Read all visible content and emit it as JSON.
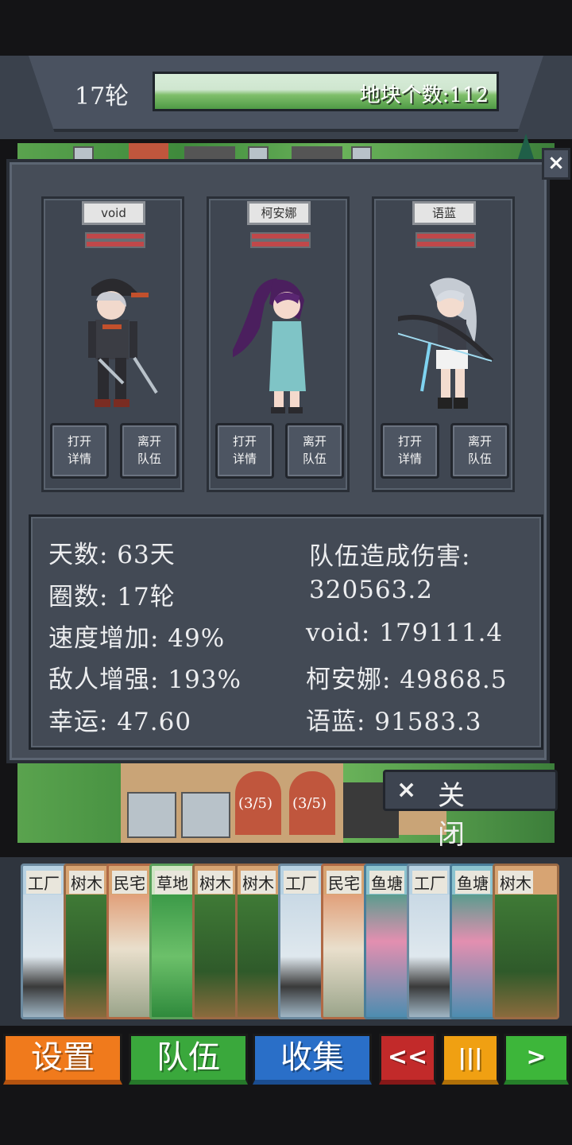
{
  "header": {
    "round": "17轮",
    "tile_count": "地块个数:112"
  },
  "party": [
    {
      "name": "void",
      "buttons": [
        "打开\n详情",
        "离开\n队伍"
      ]
    },
    {
      "name": "柯安娜",
      "buttons": [
        "打开\n详情",
        "离开\n队伍"
      ]
    },
    {
      "name": "语蓝",
      "buttons": [
        "打开\n详情",
        "离开\n队伍"
      ]
    }
  ],
  "stats": {
    "days": "天数: 63天",
    "laps": "圈数: 17轮",
    "speed": "速度增加: 49%",
    "enemy": "敌人增强: 193%",
    "luck": "幸运: 47.60",
    "damage_title": "队伍造成伤害:",
    "damage_total": "320563.2",
    "damage_void": "void: 179111.4",
    "damage_keanna": "柯安娜: 49868.5",
    "damage_yulan": "语蓝: 91583.3"
  },
  "dialog": {
    "close_x": "×",
    "close_label": "关 闭"
  },
  "map_labels": [
    "(3/5)",
    "(3/5)"
  ],
  "deck": [
    "工厂",
    "树木",
    "民宅",
    "草地",
    "树木",
    "树木",
    "工厂",
    "民宅",
    "鱼塘",
    "工厂",
    "鱼塘",
    "树木"
  ],
  "menu": {
    "settings": "设置",
    "team": "队伍",
    "collect": "收集",
    "rewind": "<<",
    "pause": "|||",
    "next": ">"
  },
  "colors": {
    "panel": "#464d58",
    "menu_settings": "#f07a1c",
    "menu_team": "#3aa83c",
    "menu_collect": "#2a6fc8",
    "menu_rewind": "#c22a2a",
    "menu_pause": "#f0a012",
    "menu_next": "#3db63a"
  }
}
